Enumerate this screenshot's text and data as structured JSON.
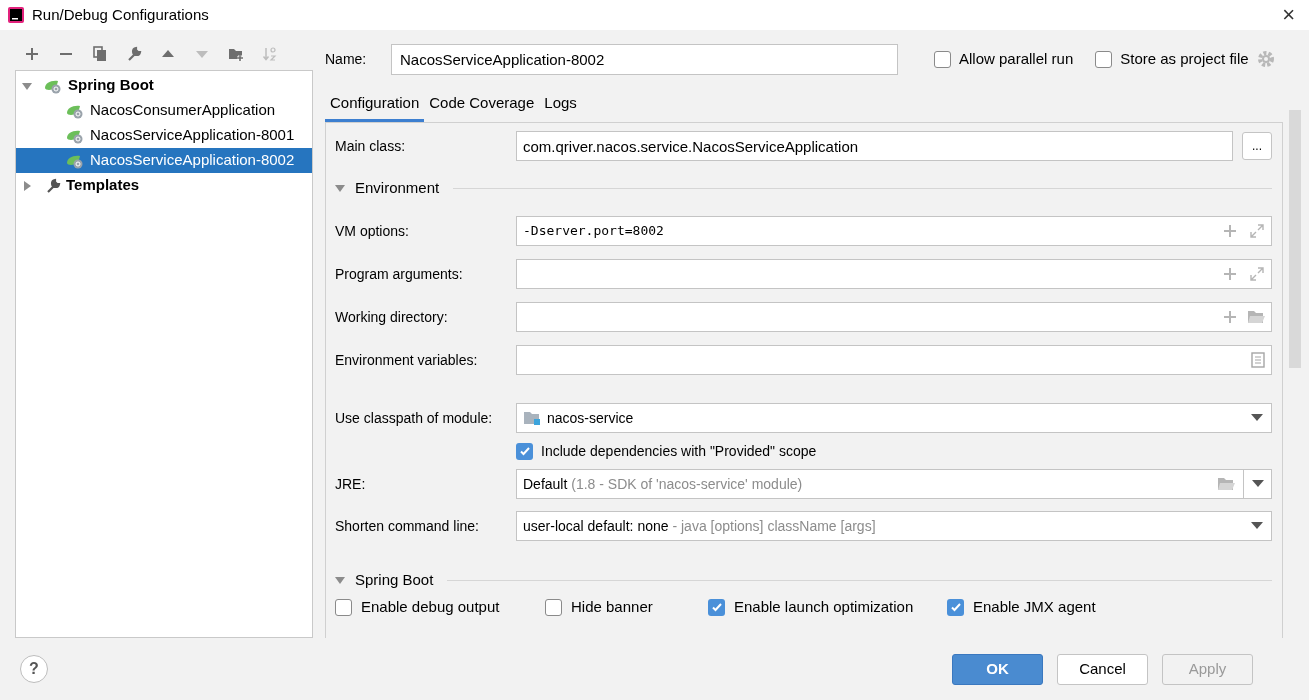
{
  "window": {
    "title": "Run/Debug Configurations",
    "close": "×"
  },
  "toolbar": [
    {
      "kind": "add",
      "disabled": false
    },
    {
      "kind": "remove",
      "disabled": false
    },
    {
      "kind": "copy",
      "disabled": false
    },
    {
      "kind": "edit",
      "disabled": false
    },
    {
      "kind": "up",
      "disabled": false
    },
    {
      "kind": "down",
      "disabled": true
    },
    {
      "kind": "folder",
      "disabled": false
    },
    {
      "kind": "sort",
      "disabled": true
    }
  ],
  "tree": [
    {
      "label": "Spring Boot",
      "kind": "spring",
      "expanded": true,
      "selected": false,
      "children": [
        {
          "label": "NacosConsumerApplication",
          "kind": "spring",
          "selected": false
        },
        {
          "label": "NacosServiceApplication-8001",
          "kind": "spring",
          "selected": false
        },
        {
          "label": "NacosServiceApplication-8002",
          "kind": "spring",
          "selected": true
        }
      ]
    },
    {
      "label": "Templates",
      "kind": "wrench",
      "expanded": false,
      "selected": false
    }
  ],
  "name": {
    "label": "Name:",
    "value": "NacosServiceApplication-8002"
  },
  "header_options": [
    {
      "label": "Allow parallel run",
      "checked": false
    },
    {
      "label": "Store as project file",
      "checked": false
    }
  ],
  "tabs": [
    {
      "label": "Configuration",
      "selected": true
    },
    {
      "label": "Code Coverage",
      "selected": false
    },
    {
      "label": "Logs",
      "selected": false
    }
  ],
  "main_class": {
    "label": "Main class:",
    "value": "com.qriver.nacos.service.NacosServiceApplication",
    "button": "..."
  },
  "environment": {
    "title": "Environment",
    "expanded": true,
    "fields": [
      {
        "label": "VM options:",
        "value": "-Dserver.port=8002",
        "kind": "expand"
      },
      {
        "label": "Program arguments:",
        "kind": "expand"
      },
      {
        "label": "Working directory:",
        "kind": "folder"
      },
      {
        "label": "Environment variables:",
        "kind": "list"
      }
    ]
  },
  "module": {
    "label": "Use classpath of module:",
    "value": "nacos-service"
  },
  "include_provided": {
    "label": "Include dependencies with \"Provided\" scope",
    "checked": true
  },
  "jre": {
    "label": "JRE:",
    "value": "Default",
    "hint": "(1.8 - SDK of 'nacos-service' module)"
  },
  "shorten": {
    "label": "Shorten command line:",
    "value": "user-local default: none",
    "hint": "- java [options] className [args]"
  },
  "spring_boot": {
    "title": "Spring Boot",
    "expanded": true,
    "options": [
      {
        "label": "Enable debug output",
        "checked": false
      },
      {
        "label": "Hide banner",
        "checked": false
      },
      {
        "label": "Enable launch optimization",
        "checked": true
      },
      {
        "label": "Enable JMX agent",
        "checked": true
      }
    ]
  },
  "footer": {
    "help": "?",
    "buttons": [
      {
        "label": "OK",
        "kind": "primary",
        "disabled": false
      },
      {
        "label": "Cancel",
        "kind": "normal",
        "disabled": false
      },
      {
        "label": "Apply",
        "kind": "normal",
        "disabled": true
      }
    ]
  }
}
